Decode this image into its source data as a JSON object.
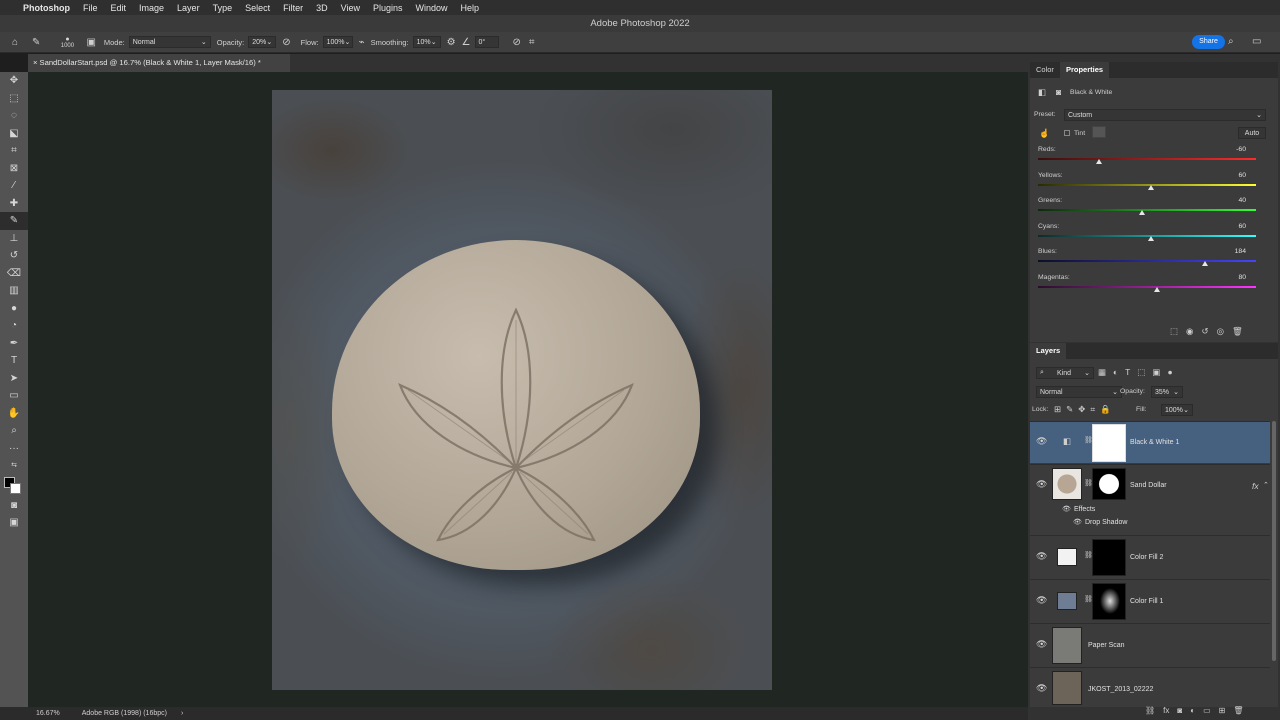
{
  "menubar": {
    "apple": "",
    "app": "Photoshop",
    "items": [
      "File",
      "Edit",
      "Image",
      "Layer",
      "Type",
      "Select",
      "Filter",
      "3D",
      "View",
      "Plugins",
      "Window",
      "Help"
    ]
  },
  "window_title": "Adobe Photoshop 2022",
  "options": {
    "brush_size": "1000",
    "mode_label": "Mode:",
    "mode_value": "Normal",
    "opacity_label": "Opacity:",
    "opacity_value": "20%",
    "flow_label": "Flow:",
    "flow_value": "100%",
    "smoothing_label": "Smoothing:",
    "smoothing_value": "10%",
    "angle_value": "0°",
    "share_label": "Share"
  },
  "document_tab": "SandDollarStart.psd @ 16.7% (Black & White 1, Layer Mask/16) *",
  "status": {
    "zoom": "16.67%",
    "profile": "Adobe RGB (1998) (16bpc)"
  },
  "properties": {
    "tabs": [
      "Color",
      "Properties"
    ],
    "adjustment_name": "Black & White",
    "preset_label": "Preset:",
    "preset_value": "Custom",
    "tint_label": "Tint",
    "auto_label": "Auto",
    "sliders": [
      {
        "label": "Reds:",
        "value": "-60",
        "fraction": 0.28,
        "from": "#3a0e0e",
        "to": "#ff2a2a"
      },
      {
        "label": "Yellows:",
        "value": "60",
        "fraction": 0.52,
        "from": "#2a2a00",
        "to": "#ffff33"
      },
      {
        "label": "Greens:",
        "value": "40",
        "fraction": 0.48,
        "from": "#0e2a0e",
        "to": "#33ff33"
      },
      {
        "label": "Cyans:",
        "value": "60",
        "fraction": 0.52,
        "from": "#0e2a2a",
        "to": "#33ffff"
      },
      {
        "label": "Blues:",
        "value": "184",
        "fraction": 0.77,
        "from": "#0e0e2a",
        "to": "#4444ff"
      },
      {
        "label": "Magentas:",
        "value": "80",
        "fraction": 0.55,
        "from": "#2a0e2a",
        "to": "#ff33ff"
      }
    ]
  },
  "layers": {
    "title": "Layers",
    "filter_kind": "Kind",
    "blend_mode": "Normal",
    "opacity_label": "Opacity:",
    "opacity_value": "35%",
    "lock_label": "Lock:",
    "fill_label": "Fill:",
    "fill_value": "100%",
    "items": [
      {
        "name": "Black & White 1"
      },
      {
        "name": "Sand Dollar",
        "effects_label": "Effects",
        "effect": "Drop Shadow"
      },
      {
        "name": "Color Fill 2"
      },
      {
        "name": "Color Fill 1"
      },
      {
        "name": "Paper Scan"
      },
      {
        "name": "JKOST_2013_02222"
      }
    ]
  }
}
